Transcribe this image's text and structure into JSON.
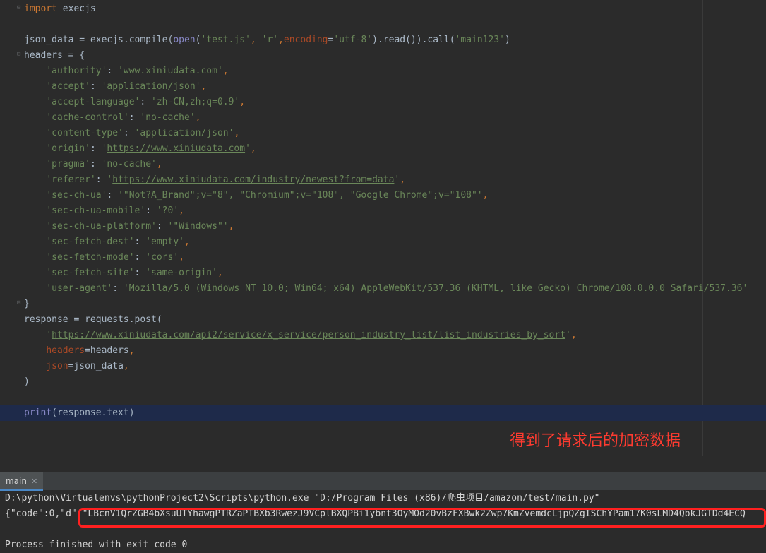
{
  "editor": {
    "lines": [
      {
        "segs": [
          [
            "kw",
            "import"
          ],
          [
            "plain",
            " execjs"
          ]
        ]
      },
      {
        "segs": []
      },
      {
        "segs": [
          [
            "plain",
            "json_data = execjs.compile("
          ],
          [
            "bi",
            "open"
          ],
          [
            "plain",
            "("
          ],
          [
            "str",
            "'test.js'"
          ],
          [
            "kw",
            ","
          ],
          [
            "plain",
            " "
          ],
          [
            "str",
            "'r'"
          ],
          [
            "kw",
            ","
          ],
          [
            "param",
            "encoding"
          ],
          [
            "plain",
            "="
          ],
          [
            "str",
            "'utf-8'"
          ],
          [
            "plain",
            ").read()).call("
          ],
          [
            "str",
            "'main123'"
          ],
          [
            "plain",
            ")"
          ]
        ]
      },
      {
        "segs": [
          [
            "plain",
            "headers = {"
          ]
        ]
      },
      {
        "segs": [
          [
            "plain",
            "    "
          ],
          [
            "str",
            "'authority'"
          ],
          [
            "plain",
            ": "
          ],
          [
            "str",
            "'www.xiniudata.com'"
          ],
          [
            "kw",
            ","
          ]
        ]
      },
      {
        "segs": [
          [
            "plain",
            "    "
          ],
          [
            "str",
            "'accept'"
          ],
          [
            "plain",
            ": "
          ],
          [
            "str",
            "'application/json'"
          ],
          [
            "kw",
            ","
          ]
        ]
      },
      {
        "segs": [
          [
            "plain",
            "    "
          ],
          [
            "str",
            "'accept-language'"
          ],
          [
            "plain",
            ": "
          ],
          [
            "str",
            "'zh-CN,zh;q=0.9'"
          ],
          [
            "kw",
            ","
          ]
        ]
      },
      {
        "segs": [
          [
            "plain",
            "    "
          ],
          [
            "str",
            "'cache-control'"
          ],
          [
            "plain",
            ": "
          ],
          [
            "str",
            "'no-cache'"
          ],
          [
            "kw",
            ","
          ]
        ]
      },
      {
        "segs": [
          [
            "plain",
            "    "
          ],
          [
            "str",
            "'content-type'"
          ],
          [
            "plain",
            ": "
          ],
          [
            "str",
            "'application/json'"
          ],
          [
            "kw",
            ","
          ]
        ]
      },
      {
        "segs": [
          [
            "plain",
            "    "
          ],
          [
            "str",
            "'origin'"
          ],
          [
            "plain",
            ": "
          ],
          [
            "str",
            "'"
          ],
          [
            "str url",
            "https://www.xiniudata.com"
          ],
          [
            "str",
            "'"
          ],
          [
            "kw",
            ","
          ]
        ]
      },
      {
        "segs": [
          [
            "plain",
            "    "
          ],
          [
            "str",
            "'pragma'"
          ],
          [
            "plain",
            ": "
          ],
          [
            "str",
            "'no-cache'"
          ],
          [
            "kw",
            ","
          ]
        ]
      },
      {
        "segs": [
          [
            "plain",
            "    "
          ],
          [
            "str",
            "'referer'"
          ],
          [
            "plain",
            ": "
          ],
          [
            "str",
            "'"
          ],
          [
            "str url",
            "https://www.xiniudata.com/industry/newest?from=data"
          ],
          [
            "str",
            "'"
          ],
          [
            "kw",
            ","
          ]
        ]
      },
      {
        "segs": [
          [
            "plain",
            "    "
          ],
          [
            "str",
            "'sec-ch-ua'"
          ],
          [
            "plain",
            ": "
          ],
          [
            "str",
            "'\"Not?A_Brand\";v=\"8\", \"Chromium\";v=\"108\", \"Google Chrome\";v=\"108\"'"
          ],
          [
            "kw",
            ","
          ]
        ]
      },
      {
        "segs": [
          [
            "plain",
            "    "
          ],
          [
            "str",
            "'sec-ch-ua-mobile'"
          ],
          [
            "plain",
            ": "
          ],
          [
            "str",
            "'?0'"
          ],
          [
            "kw",
            ","
          ]
        ]
      },
      {
        "segs": [
          [
            "plain",
            "    "
          ],
          [
            "str",
            "'sec-ch-ua-platform'"
          ],
          [
            "plain",
            ": "
          ],
          [
            "str",
            "'\"Windows\"'"
          ],
          [
            "kw",
            ","
          ]
        ]
      },
      {
        "segs": [
          [
            "plain",
            "    "
          ],
          [
            "str",
            "'sec-fetch-dest'"
          ],
          [
            "plain",
            ": "
          ],
          [
            "str",
            "'empty'"
          ],
          [
            "kw",
            ","
          ]
        ]
      },
      {
        "segs": [
          [
            "plain",
            "    "
          ],
          [
            "str",
            "'sec-fetch-mode'"
          ],
          [
            "plain",
            ": "
          ],
          [
            "str",
            "'cors'"
          ],
          [
            "kw",
            ","
          ]
        ]
      },
      {
        "segs": [
          [
            "plain",
            "    "
          ],
          [
            "str",
            "'sec-fetch-site'"
          ],
          [
            "plain",
            ": "
          ],
          [
            "str",
            "'same-origin'"
          ],
          [
            "kw",
            ","
          ]
        ]
      },
      {
        "segs": [
          [
            "plain",
            "    "
          ],
          [
            "str",
            "'user-agent'"
          ],
          [
            "plain",
            ": "
          ],
          [
            "str url",
            "'Mozilla/5.0 (Windows NT 10.0; Win64; x64) AppleWebKit/537.36 (KHTML, like Gecko) Chrome/108.0.0.0 Safari/537.36'"
          ]
        ]
      },
      {
        "segs": [
          [
            "plain",
            "}"
          ]
        ]
      },
      {
        "segs": [
          [
            "plain",
            "response = requests.post("
          ]
        ]
      },
      {
        "segs": [
          [
            "plain",
            "    "
          ],
          [
            "str",
            "'"
          ],
          [
            "str url",
            "https://www.xiniudata.com/api2/service/x_service/person_industry_list/list_industries_by_sort"
          ],
          [
            "str",
            "'"
          ],
          [
            "kw",
            ","
          ]
        ]
      },
      {
        "segs": [
          [
            "plain",
            "    "
          ],
          [
            "param",
            "headers"
          ],
          [
            "plain",
            "=headers"
          ],
          [
            "kw",
            ","
          ]
        ]
      },
      {
        "segs": [
          [
            "plain",
            "    "
          ],
          [
            "param",
            "json"
          ],
          [
            "plain",
            "=json_data"
          ],
          [
            "kw",
            ","
          ]
        ]
      },
      {
        "segs": [
          [
            "plain",
            ")"
          ]
        ]
      },
      {
        "segs": []
      },
      {
        "segs": [
          [
            "bi",
            "print"
          ],
          [
            "plain",
            "(response.text)"
          ]
        ],
        "current": true
      }
    ],
    "annotation": "得到了请求后的加密数据"
  },
  "run_panel": {
    "tab_label": "main",
    "close_glyph": "✕",
    "command_line": "D:\\python\\Virtualenvs\\pythonProject2\\Scripts\\python.exe \"D:/Program Files (x86)/爬虫项目/amazon/test/main.py\"",
    "output_line": "{\"code\":0,\"d\":\"LBcnV1QrZGB4bXsuUTYhawgPTRZaPTBXb3RwezJ9VCplBXQPBi1ybnt3OyMOd20vBzFXBwk2Zwp7KmZvemdcLjpQZgISChYPam17K0sLMD4QbkJGTDd4ECQ",
    "exit_line": "Process finished with exit code 0"
  },
  "colors": {
    "background": "#2b2b2b",
    "keyword": "#cc7832",
    "string": "#6a8759",
    "builtin": "#8888c6",
    "param": "#aa4926",
    "annotation": "#ff3b30",
    "highlight_box": "#ff2020"
  }
}
